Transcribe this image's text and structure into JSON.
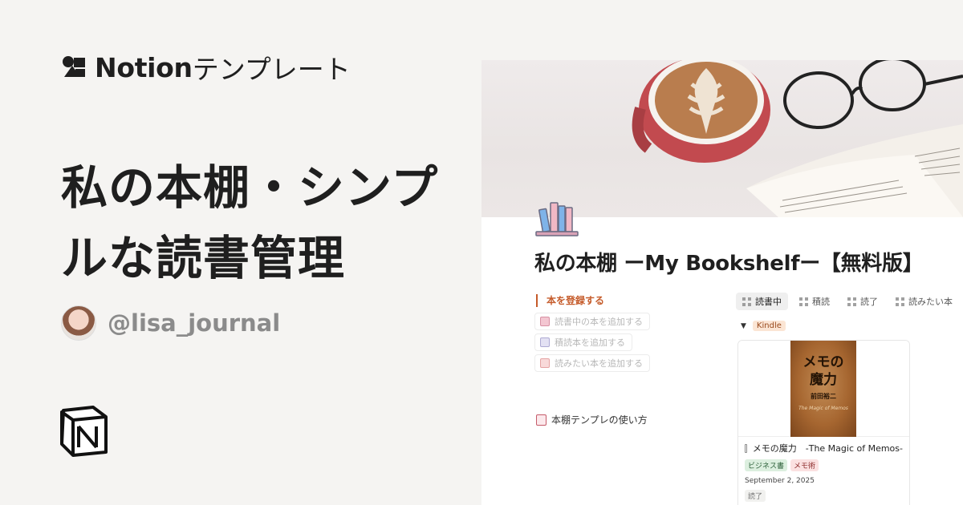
{
  "brand": {
    "name": "Notion",
    "suffix": "テンプレート"
  },
  "headline": "私の本棚・シンプルな読書管理",
  "author": {
    "handle": "@lisa_journal"
  },
  "notion_page": {
    "title": "私の本棚 ーMy Bookshelfー【無料版】",
    "register_label": "本を登録する",
    "actions": [
      {
        "label": "読書中の本を追加する",
        "color": "#e9a3b4"
      },
      {
        "label": "積読本を追加する",
        "color": "#b9b7d9"
      },
      {
        "label": "読みたい本を追加する",
        "color": "#f1b9b9"
      }
    ],
    "howto_label": "本棚テンプレの使い方",
    "tabs": [
      {
        "label": "読書中",
        "active": true
      },
      {
        "label": "積読",
        "active": false
      },
      {
        "label": "読了",
        "active": false
      },
      {
        "label": "読みたい本",
        "active": false
      }
    ],
    "group": {
      "label": "Kindle"
    },
    "card": {
      "book_cover_title": "メモの\n魔力",
      "book_cover_author": "前田裕二",
      "book_cover_subtitle": "The Magic of Memos",
      "title": "メモの魔力　-The Magic of Memos-",
      "tags": [
        {
          "label": "ビジネス書",
          "color": "green"
        },
        {
          "label": "メモ術",
          "color": "red"
        }
      ],
      "date": "September 2, 2025",
      "status": "読了"
    }
  }
}
